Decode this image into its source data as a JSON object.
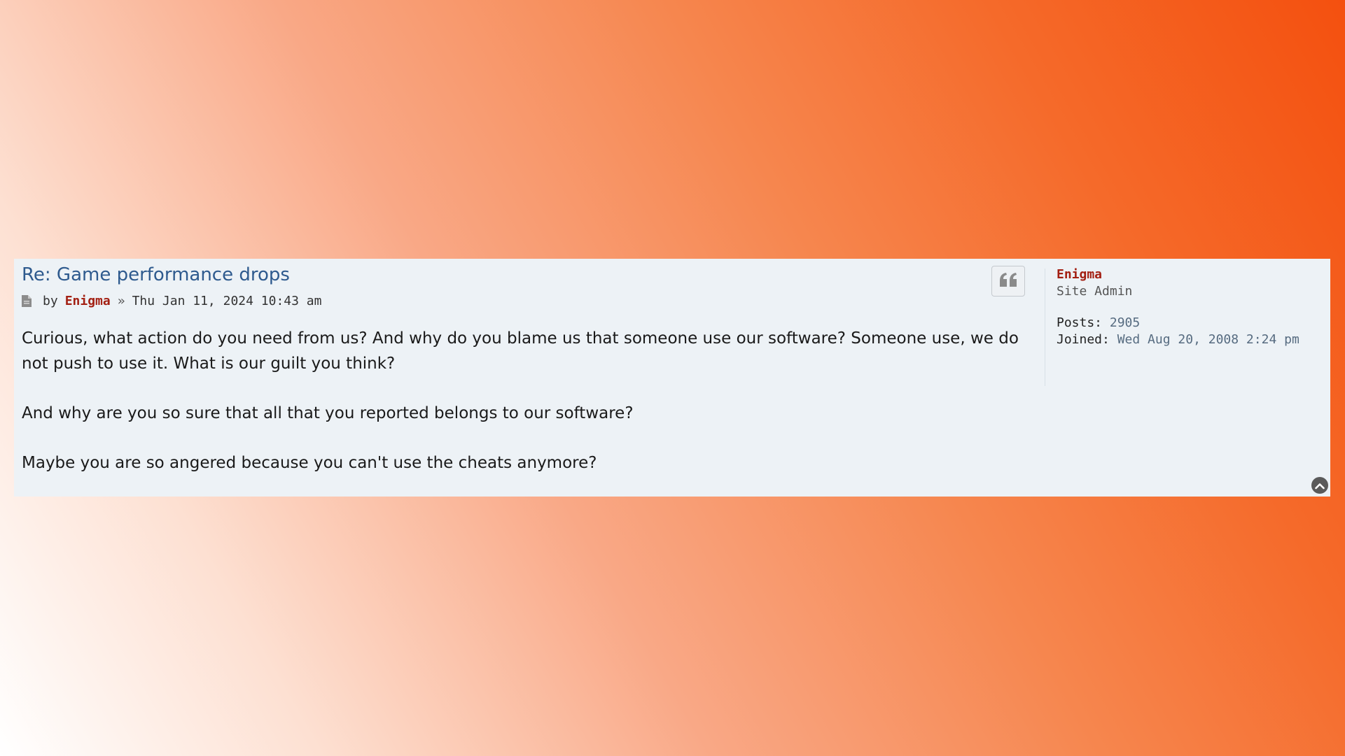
{
  "post": {
    "title": "Re: Game performance drops",
    "by_label": "by",
    "author": "Enigma",
    "separator": "»",
    "timestamp": "Thu Jan 11, 2024 10:43 am",
    "paragraphs": [
      "Curious, what action do you need from us? And why do you blame us that someone use our software? Someone use, we do not push to use it. What is our guilt you think?",
      "And why are you so sure that all that you reported belongs to our software?",
      "Maybe you are so angered because you can't use the cheats anymore?"
    ]
  },
  "profile": {
    "name": "Enigma",
    "rank": "Site Admin",
    "posts_label": "Posts:",
    "posts_value": "2905",
    "joined_label": "Joined:",
    "joined_value": "Wed Aug 20, 2008 2:24 pm"
  },
  "icons": {
    "post": "file-icon",
    "quote": "quote-icon",
    "top": "chevron-up-circle-icon"
  },
  "colors": {
    "title": "#2e5a8e",
    "author": "#a32013",
    "panel": "#edf2f6"
  }
}
